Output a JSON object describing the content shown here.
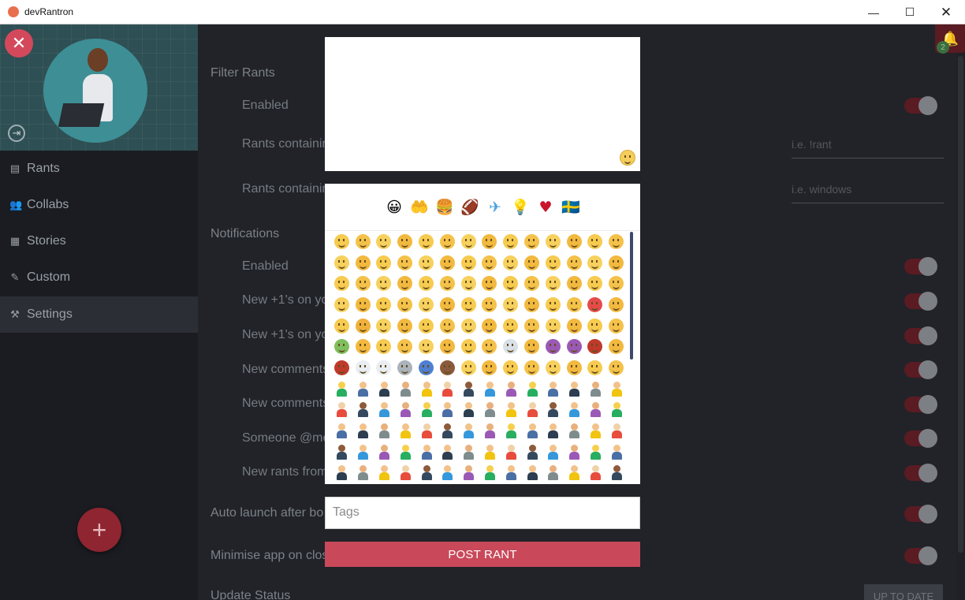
{
  "window": {
    "title": "devRantron",
    "minimize_glyph": "—",
    "maximize_glyph": "☐",
    "close_glyph": "✕"
  },
  "sidebar": {
    "close_glyph": "✕",
    "logout_glyph": "⇥",
    "items": [
      {
        "label": "Rants",
        "icon": "rants-icon",
        "glyph": "▤"
      },
      {
        "label": "Collabs",
        "icon": "users-icon",
        "glyph": "👥"
      },
      {
        "label": "Stories",
        "icon": "book-icon",
        "glyph": "▦"
      },
      {
        "label": "Custom",
        "icon": "pencil-icon",
        "glyph": "✎"
      },
      {
        "label": "Settings",
        "icon": "tools-icon",
        "glyph": "⚒"
      }
    ],
    "fab_glyph": "+"
  },
  "settings": {
    "filter_section": "Filter Rants",
    "filter_enabled": "Enabled",
    "rants_containing_1": "Rants containir",
    "rants_containing_1_placeholder": "i.e. !rant",
    "rants_containing_2": "Rants containir",
    "rants_containing_2_placeholder": "i.e. windows",
    "notifications_section": "Notifications",
    "notif_enabled": "Enabled",
    "new_plus1_rants": "New +1's on yo",
    "new_plus1_comments": "New +1's on yo",
    "new_comments_1": "New comments",
    "new_comments_2": "New comments",
    "mentions": "Someone @me",
    "new_rants_from": "New rants from",
    "auto_launch": "Auto launch after bo",
    "minimise": "Minimise app on clos",
    "update_status": "Update Status",
    "up_to_date": "UP TO DATE",
    "bell_glyph": "🔔",
    "notification_count": "2"
  },
  "composer": {
    "rant_text": "",
    "tags_placeholder": "Tags",
    "post_label": "POST RANT",
    "categories": [
      {
        "glyph": "😀",
        "name": "smileys-icon"
      },
      {
        "glyph": "🤲",
        "name": "hands-icon"
      },
      {
        "glyph": "🍔",
        "name": "food-icon"
      },
      {
        "glyph": "🏈",
        "name": "sports-icon"
      },
      {
        "glyph": "✈",
        "name": "travel-icon"
      },
      {
        "glyph": "💡",
        "name": "objects-icon"
      },
      {
        "glyph": "♥",
        "name": "symbols-icon"
      },
      {
        "glyph": "🇸🇪",
        "name": "flags-icon"
      }
    ]
  },
  "colors": {
    "accent": "#c9495a",
    "sidebar_bg": "#1a1c21",
    "main_bg": "#212328",
    "toggle_on": "#5a1b23"
  }
}
